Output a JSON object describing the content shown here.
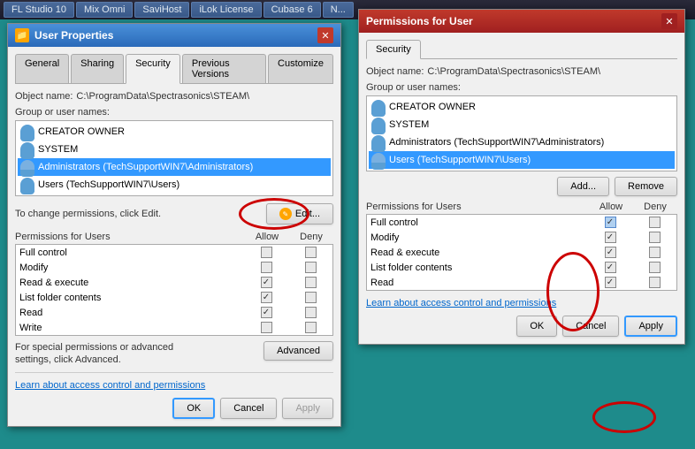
{
  "taskbar": {
    "items": [
      "FL Studio 10",
      "Mix Omni",
      "SaviHost",
      "iLok License",
      "Cubase 6",
      "N..."
    ]
  },
  "dialog1": {
    "title": "User Properties",
    "tabs": [
      "General",
      "Sharing",
      "Security",
      "Previous Versions",
      "Customize"
    ],
    "active_tab": "Security",
    "object_name_label": "Object name:",
    "object_name_value": "C:\\ProgramData\\Spectrasonics\\STEAM\\",
    "group_label": "Group or user names:",
    "users": [
      "CREATOR OWNER",
      "SYSTEM",
      "Administrators (TechSupportWIN7\\Administrators)",
      "Users (TechSupportWIN7\\Users)"
    ],
    "change_text": "To change permissions, click Edit.",
    "edit_button": "Edit...",
    "perm_header": "Permissions for Users",
    "allow_col": "Allow",
    "deny_col": "Deny",
    "permissions": [
      {
        "name": "Full control",
        "allow": false,
        "deny": false
      },
      {
        "name": "Modify",
        "allow": false,
        "deny": false
      },
      {
        "name": "Read & execute",
        "allow": true,
        "deny": false
      },
      {
        "name": "List folder contents",
        "allow": true,
        "deny": false
      },
      {
        "name": "Read",
        "allow": true,
        "deny": false
      },
      {
        "name": "Write",
        "allow": false,
        "deny": false
      }
    ],
    "special_text": "For special permissions or advanced settings, click Advanced.",
    "advanced_button": "Advanced",
    "learn_link": "Learn about access control and permissions",
    "ok_button": "OK",
    "cancel_button": "Cancel",
    "apply_button": "Apply"
  },
  "dialog2": {
    "title": "Permissions for User",
    "tab": "Security",
    "object_name_label": "Object name:",
    "object_name_value": "C:\\ProgramData\\Spectrasonics\\STEAM\\",
    "group_label": "Group or user names:",
    "users": [
      "CREATOR OWNER",
      "SYSTEM",
      "Administrators (TechSupportWIN7\\Administrators)",
      "Users (TechSupportWIN7\\Users)"
    ],
    "add_button": "Add...",
    "remove_button": "Remove",
    "perm_header": "Permissions for Users",
    "allow_col": "Allow",
    "deny_col": "Deny",
    "permissions": [
      {
        "name": "Full control",
        "allow": true,
        "deny": false
      },
      {
        "name": "Modify",
        "allow": true,
        "deny": false
      },
      {
        "name": "Read & execute",
        "allow": true,
        "deny": false
      },
      {
        "name": "List folder contents",
        "allow": true,
        "deny": false
      },
      {
        "name": "Read",
        "allow": true,
        "deny": false
      }
    ],
    "learn_link": "Learn about access control and permissions",
    "ok_button": "OK",
    "cancel_button": "Cancel",
    "apply_button": "Apply"
  }
}
